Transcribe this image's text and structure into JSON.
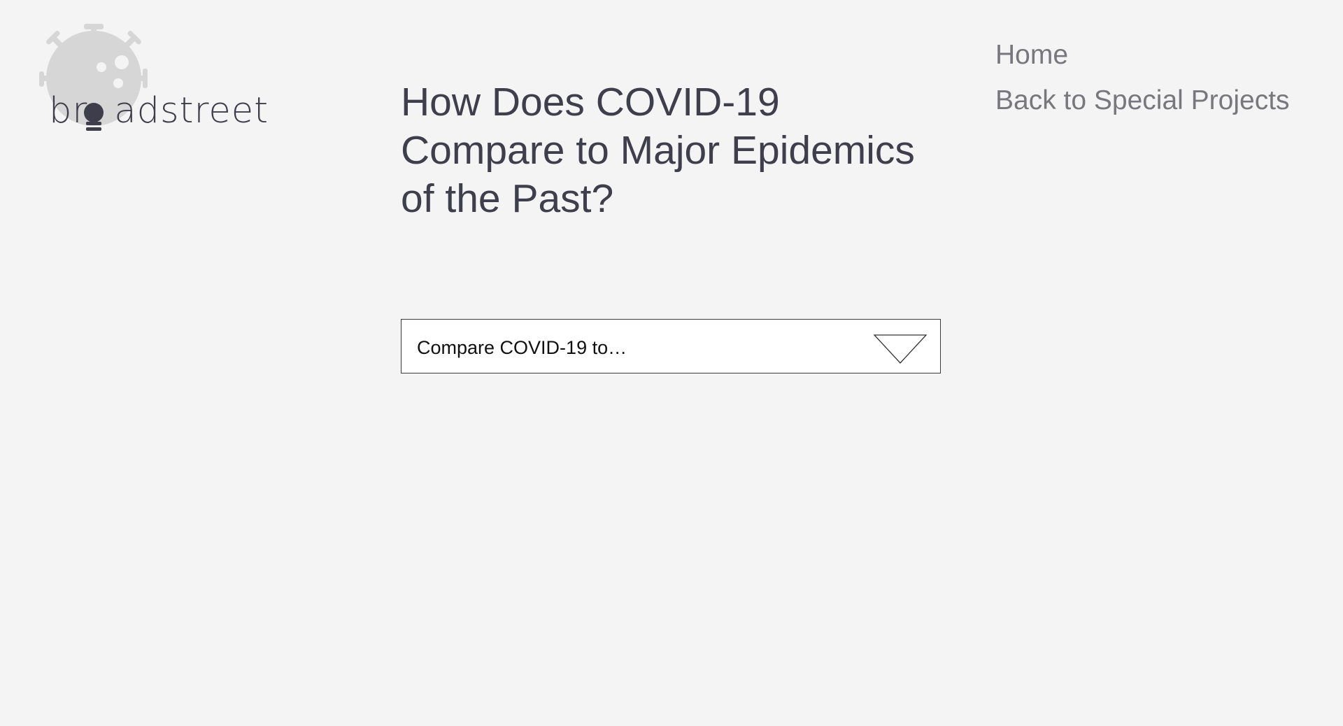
{
  "logo": {
    "text_before": "br",
    "text_after": "adstreet",
    "icon": "virus-lightbulb-icon"
  },
  "nav": {
    "home": "Home",
    "back": "Back to Special Projects"
  },
  "main": {
    "title": "How Does COVID-19 Compare to Major Epidemics of the Past?",
    "dropdown": {
      "placeholder": "Compare COVID-19 to…",
      "icon": "chevron-down-triangle-icon"
    }
  },
  "colors": {
    "background": "#f4f4f4",
    "title": "#3e3e4c",
    "nav": "#77777d",
    "logo_virus": "#d6d6d6",
    "logo_text": "#3d3d4b"
  }
}
